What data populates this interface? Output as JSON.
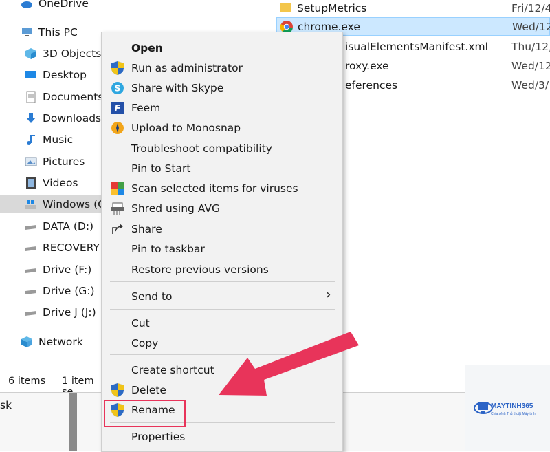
{
  "nav": {
    "items": [
      {
        "label": "OneDrive",
        "icon": "cloud-icon"
      },
      {
        "label": "This PC",
        "icon": "computer-icon"
      },
      {
        "label": "3D Objects",
        "icon": "cube-icon"
      },
      {
        "label": "Desktop",
        "icon": "desktop-icon"
      },
      {
        "label": "Documents",
        "icon": "document-icon"
      },
      {
        "label": "Downloads",
        "icon": "download-icon"
      },
      {
        "label": "Music",
        "icon": "music-icon"
      },
      {
        "label": "Pictures",
        "icon": "picture-icon"
      },
      {
        "label": "Videos",
        "icon": "video-icon"
      },
      {
        "label": "Windows (C",
        "icon": "windows-drive-icon"
      },
      {
        "label": "DATA (D:)",
        "icon": "drive-icon"
      },
      {
        "label": "RECOVERY (",
        "icon": "drive-icon"
      },
      {
        "label": "Drive (F:)",
        "icon": "drive-icon"
      },
      {
        "label": "Drive (G:)",
        "icon": "drive-icon"
      },
      {
        "label": "Drive J (J:)",
        "icon": "drive-icon"
      },
      {
        "label": "Network",
        "icon": "network-icon"
      }
    ]
  },
  "files": [
    {
      "name": "SetupMetrics",
      "date": "Fri/12/4"
    },
    {
      "name": "chrome.exe",
      "date": "Wed/12"
    },
    {
      "name": "isualElementsManifest.xml",
      "date": "Thu/12,"
    },
    {
      "name": "roxy.exe",
      "date": "Wed/12"
    },
    {
      "name": "eferences",
      "date": "Wed/3/"
    }
  ],
  "status": {
    "items_count": "6 items",
    "selected": "1 item se"
  },
  "bottom_left_text": "sk",
  "menu": {
    "items": [
      {
        "label": "Open",
        "icon": ""
      },
      {
        "label": "Run as administrator",
        "icon": "shield-icon"
      },
      {
        "label": "Share with Skype",
        "icon": "skype-icon"
      },
      {
        "label": "Feem",
        "icon": "feem-icon"
      },
      {
        "label": "Upload to Monosnap",
        "icon": "monosnap-icon"
      },
      {
        "label": "Troubleshoot compatibility",
        "icon": ""
      },
      {
        "label": "Pin to Start",
        "icon": ""
      },
      {
        "label": "Scan selected items for viruses",
        "icon": "avg-icon"
      },
      {
        "label": "Shred using AVG",
        "icon": "shredder-icon"
      },
      {
        "label": "Share",
        "icon": "share-icon"
      },
      {
        "label": "Pin to taskbar",
        "icon": ""
      },
      {
        "label": "Restore previous versions",
        "icon": ""
      },
      {
        "label": "Send to",
        "icon": ""
      },
      {
        "label": "Cut",
        "icon": ""
      },
      {
        "label": "Copy",
        "icon": ""
      },
      {
        "label": "Create shortcut",
        "icon": ""
      },
      {
        "label": "Delete",
        "icon": "shield-icon"
      },
      {
        "label": "Rename",
        "icon": "shield-icon"
      },
      {
        "label": "Properties",
        "icon": ""
      }
    ],
    "submenu_arrow": "›"
  },
  "highlight": {
    "target": "Rename",
    "color": "#e8345a"
  },
  "watermark": {
    "brand": "MAYTINH365",
    "tagline": "Chia sẻ & Thủ thuật Máy tính"
  }
}
